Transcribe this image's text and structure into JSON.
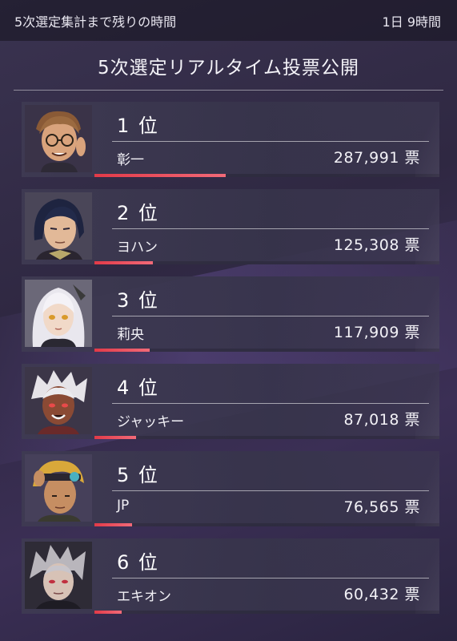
{
  "header": {
    "countdown_label": "5次選定集計まで残りの時間",
    "countdown_value": "1日 9時間"
  },
  "title": "5次選定リアルタイム投票公開",
  "accent_color": "#e23a48",
  "entries": [
    {
      "rank": "1 位",
      "name": "彰一",
      "votes": "287,991 票",
      "vote_share": 0.38,
      "portrait_icon": "character-portrait-glasses-man"
    },
    {
      "rank": "2 位",
      "name": "ヨハン",
      "votes": "125,308 票",
      "vote_share": 0.17,
      "portrait_icon": "character-portrait-dark-haired-man"
    },
    {
      "rank": "3 位",
      "name": "莉央",
      "votes": "117,909 票",
      "vote_share": 0.16,
      "portrait_icon": "character-portrait-white-haired-girl"
    },
    {
      "rank": "4 位",
      "name": "ジャッキー",
      "votes": "87,018 票",
      "vote_share": 0.12,
      "portrait_icon": "character-portrait-white-haired-woman"
    },
    {
      "rank": "5 位",
      "name": "JP",
      "votes": "76,565 票",
      "vote_share": 0.11,
      "portrait_icon": "character-portrait-blond-man"
    },
    {
      "rank": "6 位",
      "name": "エキオン",
      "votes": "60,432 票",
      "vote_share": 0.08,
      "portrait_icon": "character-portrait-grey-haired-man"
    }
  ]
}
